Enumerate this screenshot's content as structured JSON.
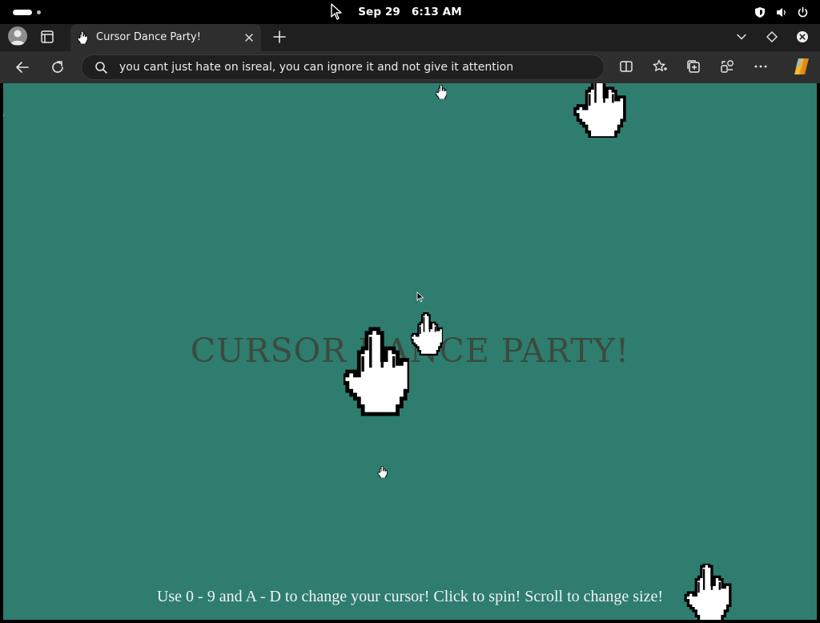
{
  "system_bar": {
    "date": "Sep 29",
    "time": "6:13 AM",
    "tray_icons": [
      "shield-icon",
      "volume-icon",
      "power-icon"
    ]
  },
  "browser": {
    "tab": {
      "title": "Cursor Dance Party!",
      "favicon": "hand-cursor-icon"
    },
    "address_bar": {
      "value": "you cant just hate on isreal, you can ignore it and not give it attention"
    },
    "tabstrip_icons": [
      "profile-icon",
      "tab-actions-icon",
      "new-tab-icon",
      "tab-list-icon",
      "workspace-icon",
      "close-window-icon"
    ],
    "toolbar_icons": [
      "back-icon",
      "refresh-icon",
      "search-icon",
      "split-screen-icon",
      "favorites-icon",
      "collections-icon",
      "extensions-icon",
      "more-icon",
      "copilot-icon"
    ]
  },
  "page": {
    "background_color": "#2e7d6f",
    "title": "CURSOR DANCE PARTY!",
    "hint": "Use 0 - 9 and A - D to change your cursor! Click to spin! Scroll to change size!"
  },
  "colors": {
    "os_bar": "#000000",
    "tabstrip": "#1f1f1f",
    "toolbar": "#2e2e2e",
    "title_text": "#3b4a3f",
    "hint_text": "#f3f3f3"
  }
}
